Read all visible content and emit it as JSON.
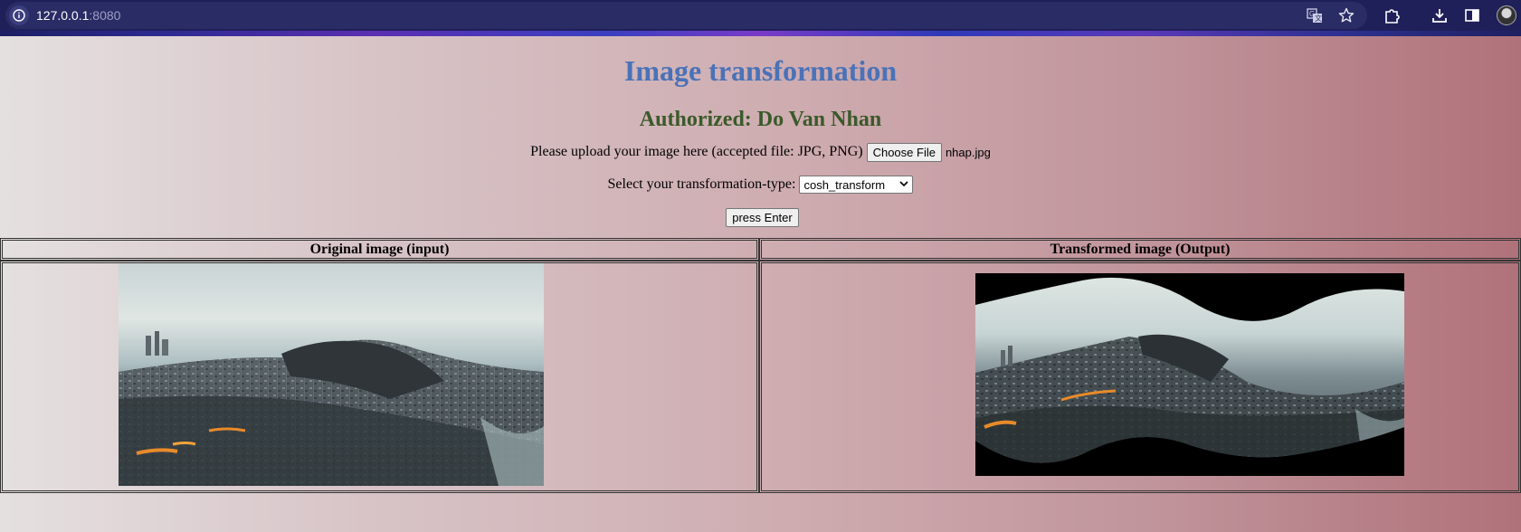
{
  "browser": {
    "url_host": "127.0.0.1",
    "url_port": ":8080"
  },
  "page": {
    "title": "Image transformation",
    "author": "Authorized: Do Van Nhan",
    "upload_label": "Please upload your image here (accepted file: JPG, PNG)",
    "choose_file_label": "Choose File",
    "file_name": "nhap.jpg",
    "select_label": "Select your transformation-type:",
    "selected_transform": "cosh_transform",
    "submit_label": "press Enter"
  },
  "table": {
    "input_header": "Original image (input)",
    "output_header": "Transformed image (Output)"
  },
  "colors": {
    "title": "#4a72b8",
    "author": "#3a5a2a"
  }
}
